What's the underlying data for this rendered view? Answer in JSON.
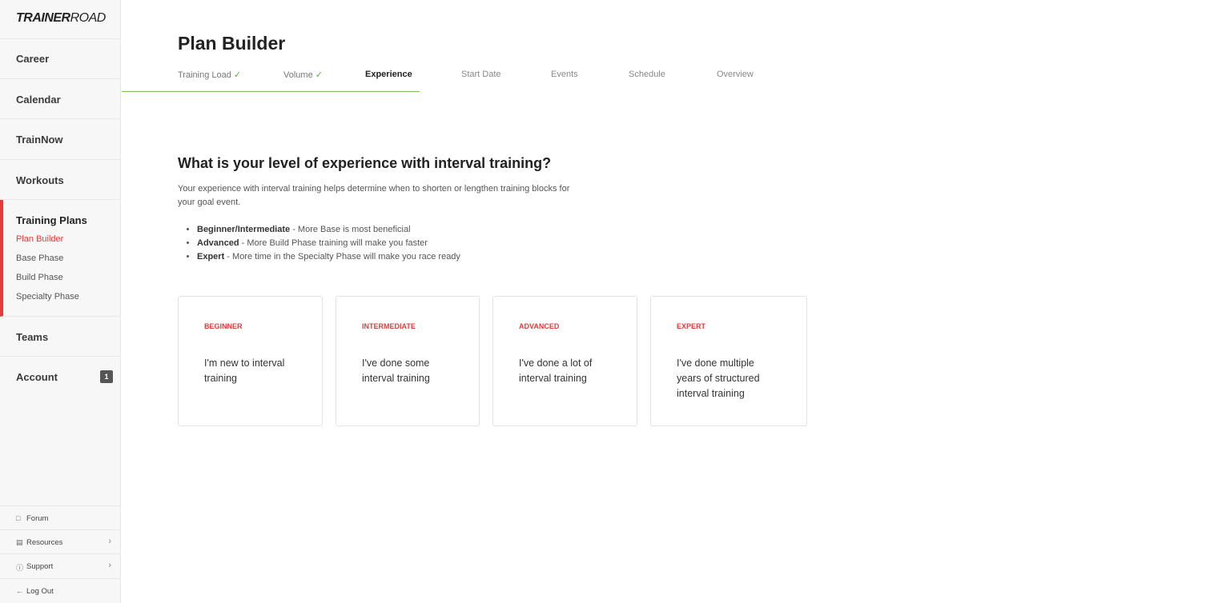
{
  "sidebar": {
    "logo": {
      "bold": "TRAINER",
      "light": "ROAD"
    },
    "items": [
      {
        "label": "Career"
      },
      {
        "label": "Calendar"
      },
      {
        "label": "TrainNow"
      },
      {
        "label": "Workouts"
      }
    ],
    "training_plans": {
      "label": "Training Plans",
      "sub_items": [
        {
          "label": "Plan Builder",
          "active": true
        },
        {
          "label": "Base Phase"
        },
        {
          "label": "Build Phase"
        },
        {
          "label": "Specialty Phase"
        }
      ]
    },
    "teams": {
      "label": "Teams"
    },
    "account": {
      "label": "Account",
      "badge": "1"
    },
    "footer": [
      {
        "label": "Forum",
        "icon": "chat-icon"
      },
      {
        "label": "Resources",
        "icon": "list-icon"
      },
      {
        "label": "Support",
        "icon": "help-icon"
      },
      {
        "label": "Log Out",
        "icon": "arrow-left-icon"
      }
    ]
  },
  "main": {
    "title": "Plan Builder",
    "tabs": [
      {
        "label": "Training Load",
        "state": "done"
      },
      {
        "label": "Volume",
        "state": "done"
      },
      {
        "label": "Experience",
        "state": "current"
      },
      {
        "label": "Start Date",
        "state": "upcoming"
      },
      {
        "label": "Events",
        "state": "upcoming"
      },
      {
        "label": "Schedule",
        "state": "upcoming"
      },
      {
        "label": "Overview",
        "state": "upcoming"
      }
    ],
    "question": "What is your level of experience with interval training?",
    "description": "Your experience with interval training helps determine when to shorten or lengthen training blocks for your goal event.",
    "bullets": [
      {
        "bold": "Beginner/Intermediate",
        "text": " - More Base is most beneficial"
      },
      {
        "bold": "Advanced",
        "text": " - More Build Phase training will make you faster"
      },
      {
        "bold": "Expert",
        "text": " - More time in the Specialty Phase will make you race ready"
      }
    ],
    "options": [
      {
        "level": "BEGINNER",
        "line1": "I'm new to interval",
        "line2": "training",
        "line3": ""
      },
      {
        "level": "INTERMEDIATE",
        "line1": "I've done some",
        "line2": "interval training",
        "line3": ""
      },
      {
        "level": "ADVANCED",
        "line1": "I've done a lot of",
        "line2": "interval training",
        "line3": ""
      },
      {
        "level": "EXPERT",
        "line1": "I've done multiple",
        "line2": "years of structured",
        "line3": "interval training"
      }
    ]
  },
  "colors": {
    "accent": "#e23b3b",
    "success": "#5aae3e"
  }
}
